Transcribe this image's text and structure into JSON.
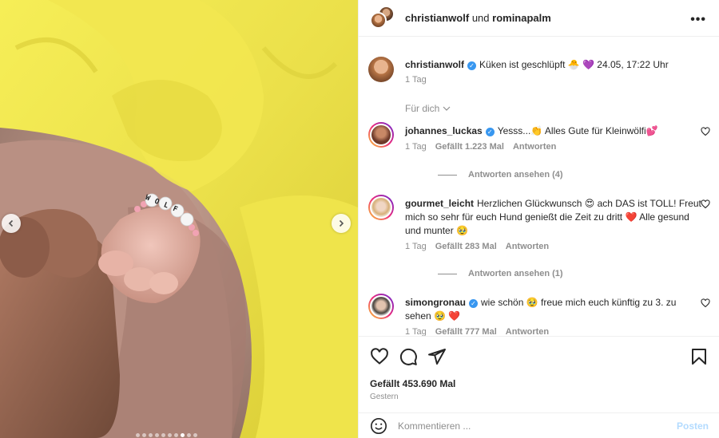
{
  "header": {
    "user1": "christianwolf",
    "joiner": "und",
    "user2": "rominapalm",
    "more": "•••"
  },
  "caption": {
    "user": "christianwolf",
    "text": "Küken ist geschlüpft 🐣 💜 24.05, 17:22 Uhr",
    "time": "1 Tag"
  },
  "filter": {
    "label": "Für dich",
    "icon": "chevron-down-icon"
  },
  "comments": [
    {
      "user": "johannes_luckas",
      "verified": true,
      "text": "Yesss...👏 Alles Gute für Kleinwölfi💕",
      "time": "1 Tag",
      "likes": "Gefällt 1.223 Mal",
      "reply": "Antworten",
      "replies": "Antworten ansehen (4)"
    },
    {
      "user": "gourmet_leicht",
      "verified": false,
      "text": "Herzlichen Glückwunsch 😍 ach DAS ist TOLL! Freut mich so sehr für euch Hund genießt die Zeit zu dritt ❤️ Alle gesund und munter 🥹",
      "time": "1 Tag",
      "likes": "Gefällt 283 Mal",
      "reply": "Antworten",
      "replies": "Antworten ansehen (1)"
    },
    {
      "user": "simongronau",
      "verified": true,
      "text": "wie schön 🥹 freue mich euch künftig zu 3. zu sehen 🥹 ❤️",
      "time": "1 Tag",
      "likes": "Gefällt 777 Mal",
      "reply": "Antworten"
    }
  ],
  "post": {
    "likes": "Gefällt 453.690 Mal",
    "date": "Gestern"
  },
  "composer": {
    "placeholder": "Kommentieren ...",
    "post_label": "Posten"
  },
  "media": {
    "bracelet_text": "WOLF",
    "slide_count": 10,
    "active_slide": 7
  },
  "colors": {
    "accent": "#0095f6",
    "verified": "#3897f0",
    "heart": "#e0245e"
  }
}
